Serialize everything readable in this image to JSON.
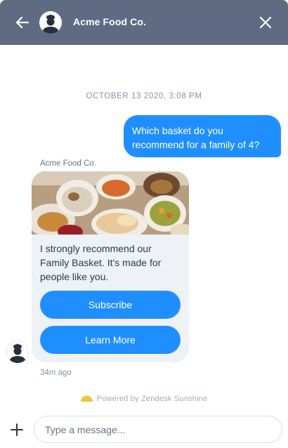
{
  "header": {
    "title": "Acme Food Co.",
    "back_icon": "arrow-left-icon",
    "close_icon": "close-icon",
    "avatar_icon": "chef-avatar-icon",
    "background_color": "#5f6b82"
  },
  "conversation": {
    "timestamp": "OCTOBER 13 2020, 3:08 PM",
    "user_message": "Which basket do you recommend for a family of 4?",
    "bot": {
      "sender_name": "Acme Food Co.",
      "card_image": "food-basket-photo",
      "card_text": "I strongly recommend our Family Basket. It's made for people like you.",
      "buttons": [
        {
          "label": "Subscribe"
        },
        {
          "label": "Learn More"
        }
      ],
      "time_ago": "34m ago"
    },
    "accent_color": "#1f8fff"
  },
  "footer": {
    "powered_by": "Powered by Zendesk Sunshine",
    "attach_icon": "plus-icon",
    "composer_placeholder": "Type a message..."
  }
}
